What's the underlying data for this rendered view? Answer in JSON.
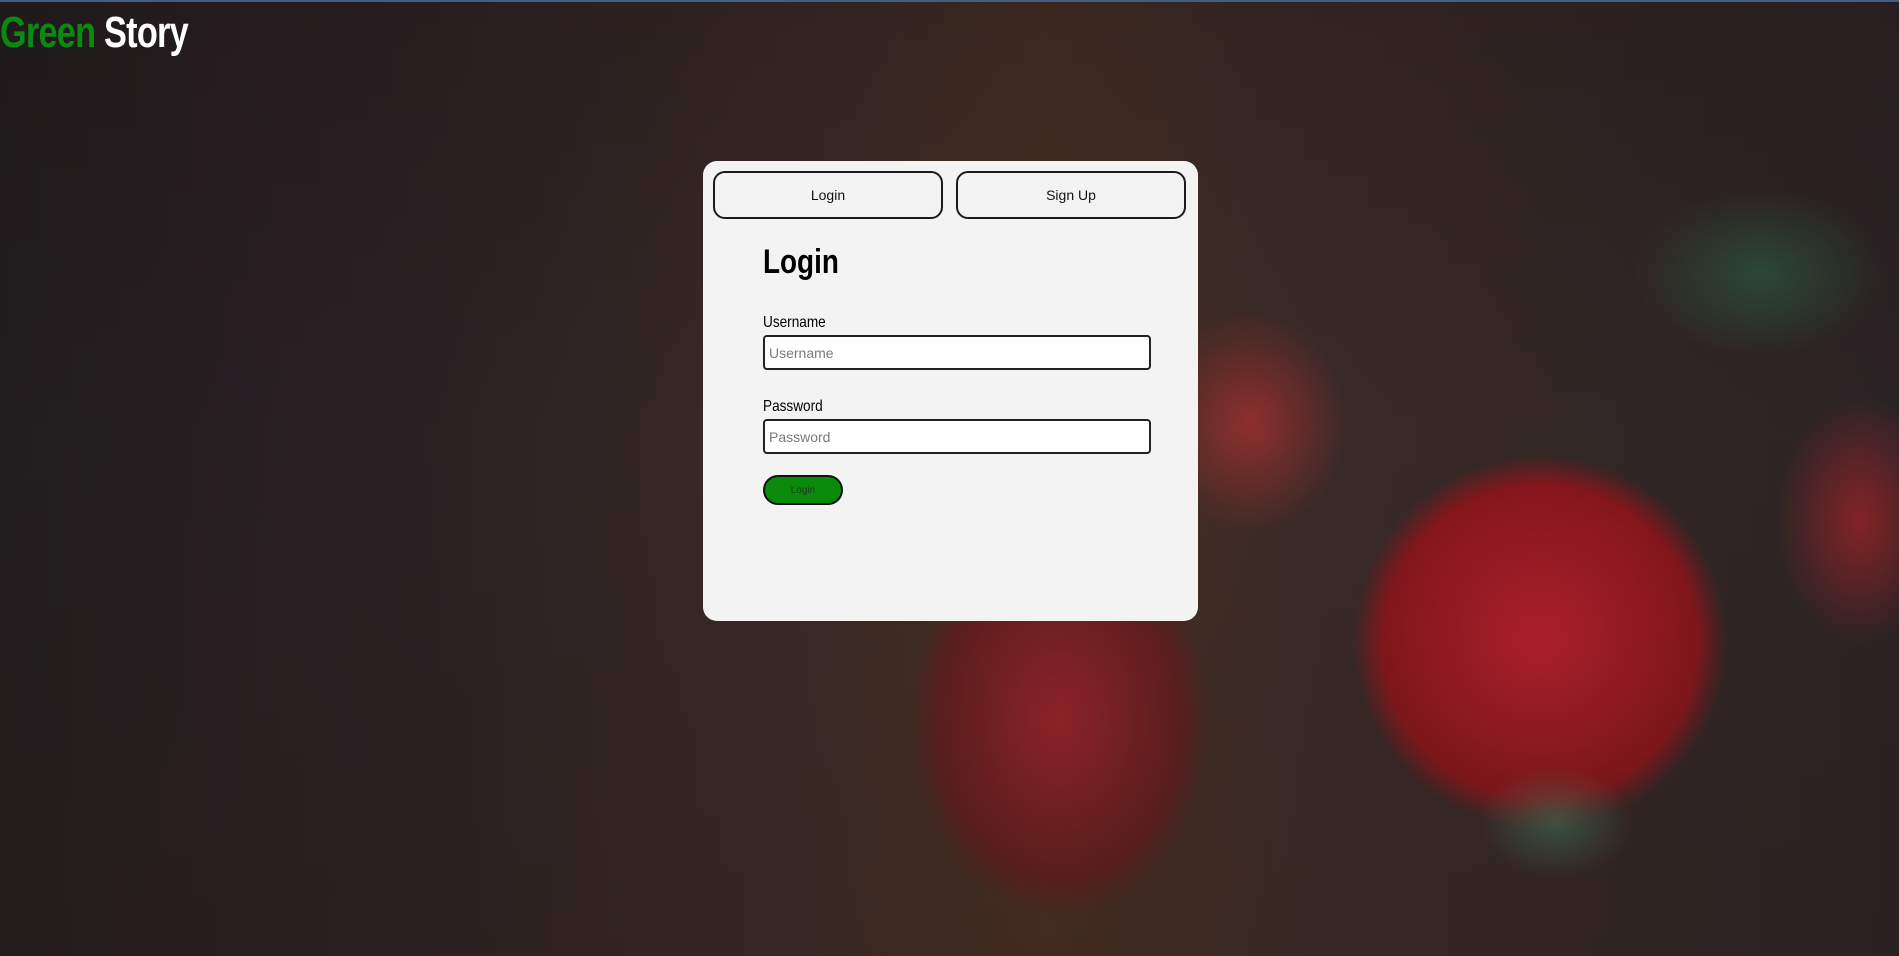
{
  "brand": {
    "green_word": "Green",
    "white_word": "Story",
    "green_color": "#0b8a12"
  },
  "background": {
    "description_color_dark": "#2a2125",
    "accent_red": "#c6202c"
  },
  "tabs": {
    "login_label": "Login",
    "signup_label": "Sign Up"
  },
  "form": {
    "title": "Login",
    "username_label": "Username",
    "username_placeholder": "Username",
    "password_label": "Password",
    "password_placeholder": "Password",
    "submit_label": "Login",
    "submit_color": "#0a8a0a"
  }
}
